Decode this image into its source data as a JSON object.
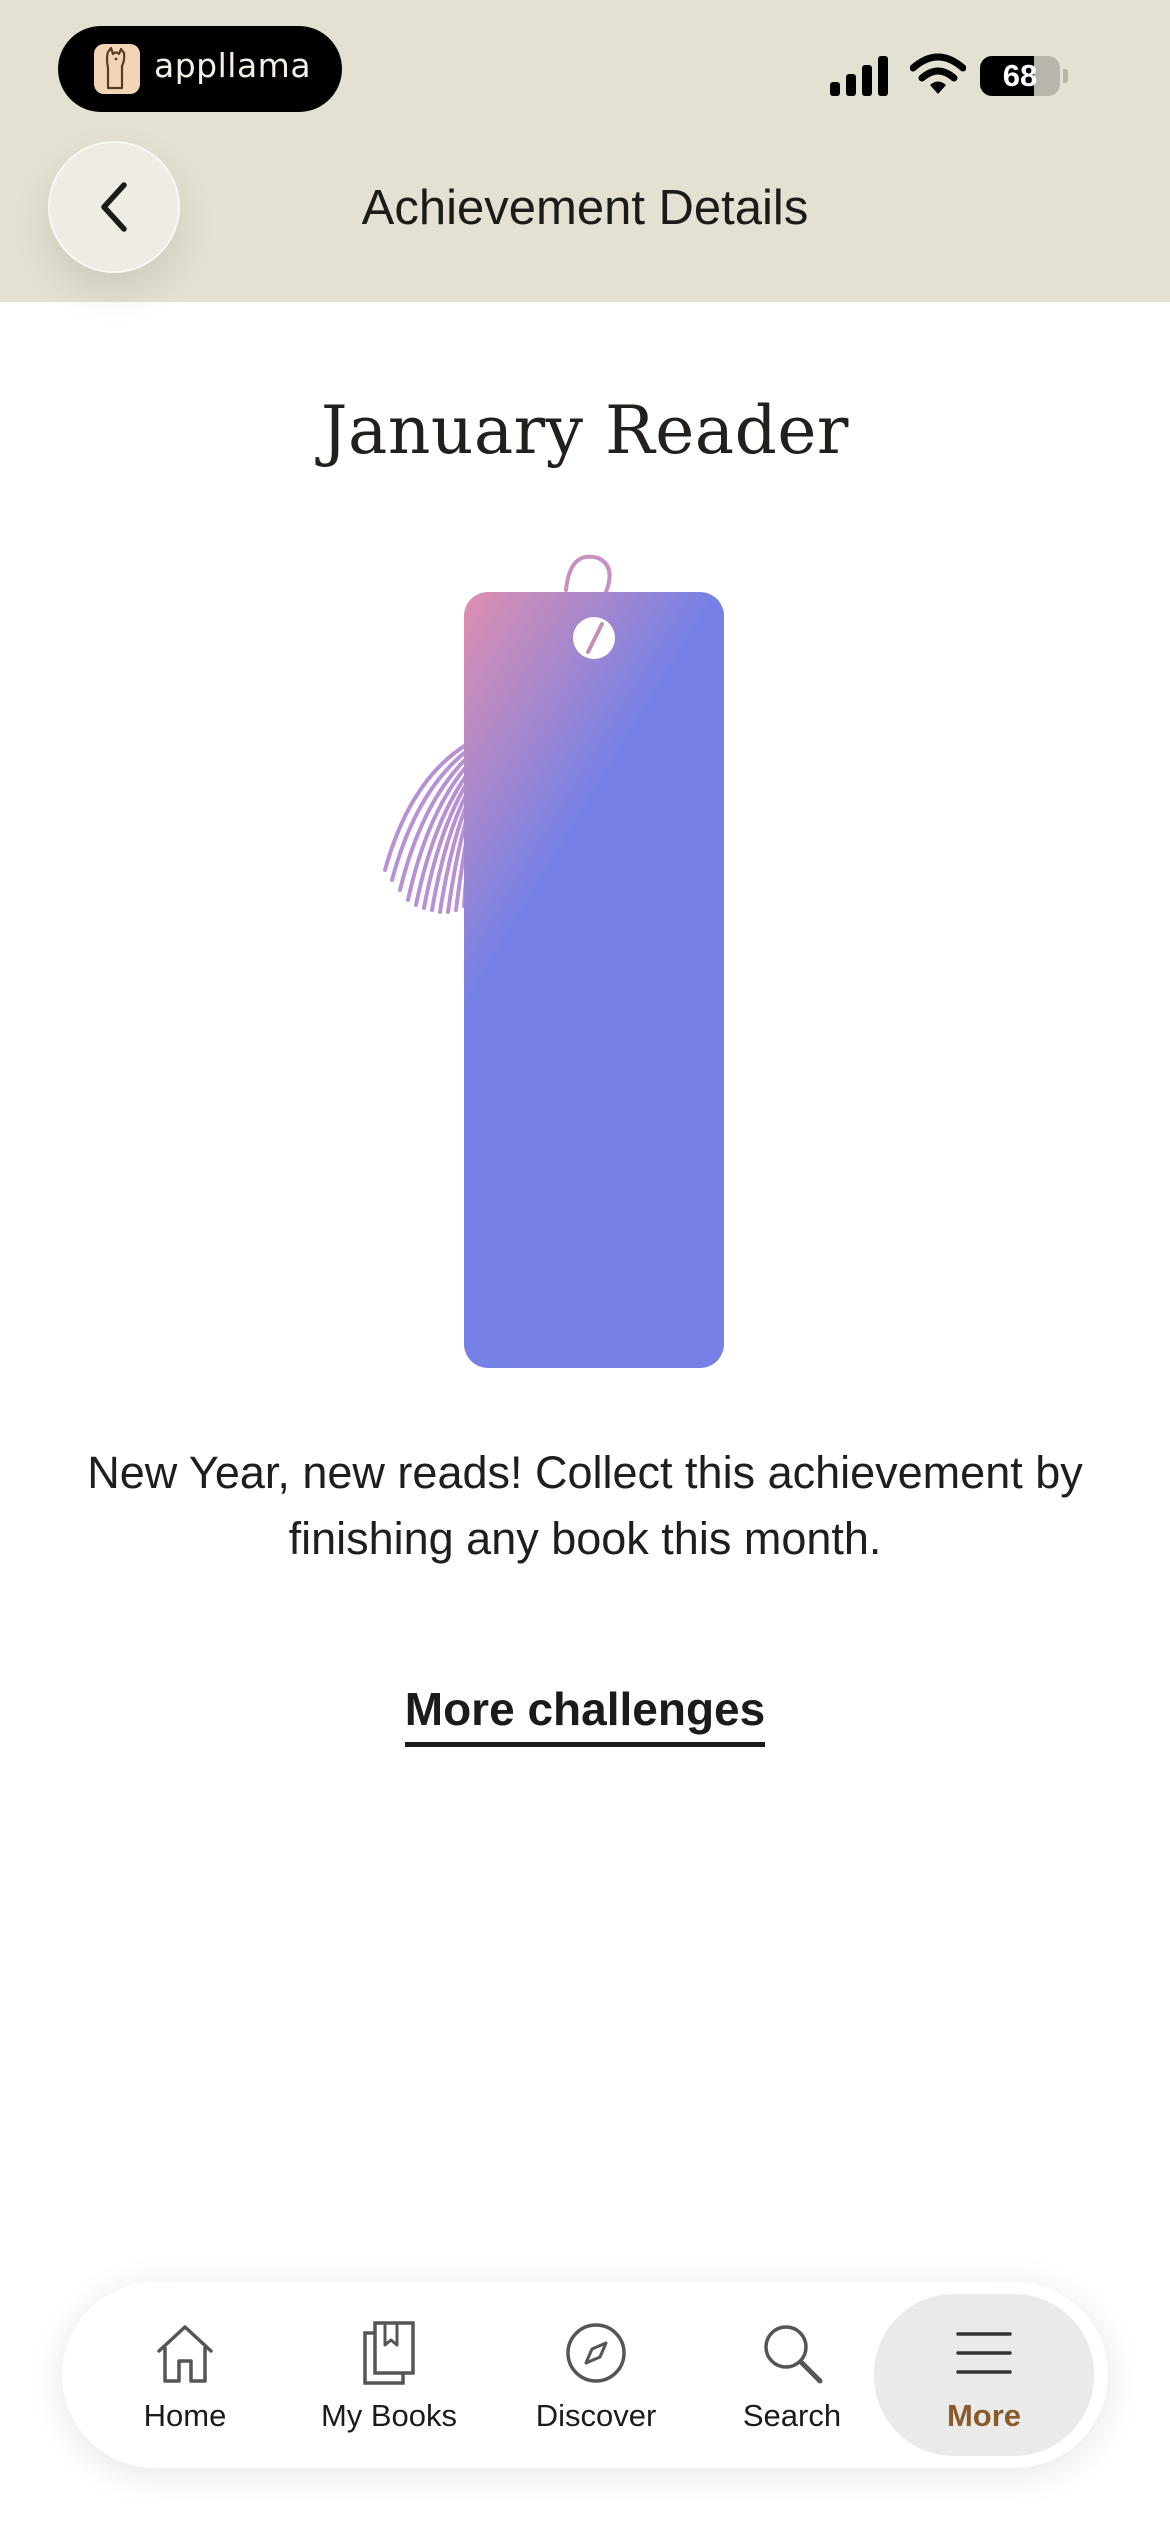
{
  "status_bar": {
    "app_name": "appllama",
    "battery": "68"
  },
  "header": {
    "title": "Achievement Details",
    "back_icon": "chevron-left-icon"
  },
  "achievement": {
    "title": "January Reader",
    "description": "New Year, new reads! Collect this achievement by finishing any book this month.",
    "badge_icon": "bookmark-with-tassel",
    "badge_colors": {
      "top": "#e08fb0",
      "bottom": "#7581e6",
      "tassel": "#b891d4"
    }
  },
  "more_challenges": "More challenges",
  "nav": {
    "tabs": [
      {
        "label": "Home",
        "icon": "home-icon"
      },
      {
        "label": "My Books",
        "icon": "books-icon"
      },
      {
        "label": "Discover",
        "icon": "compass-icon"
      },
      {
        "label": "Search",
        "icon": "search-icon"
      },
      {
        "label": "More",
        "icon": "menu-icon"
      }
    ],
    "active_color": "#8a5a2b"
  }
}
